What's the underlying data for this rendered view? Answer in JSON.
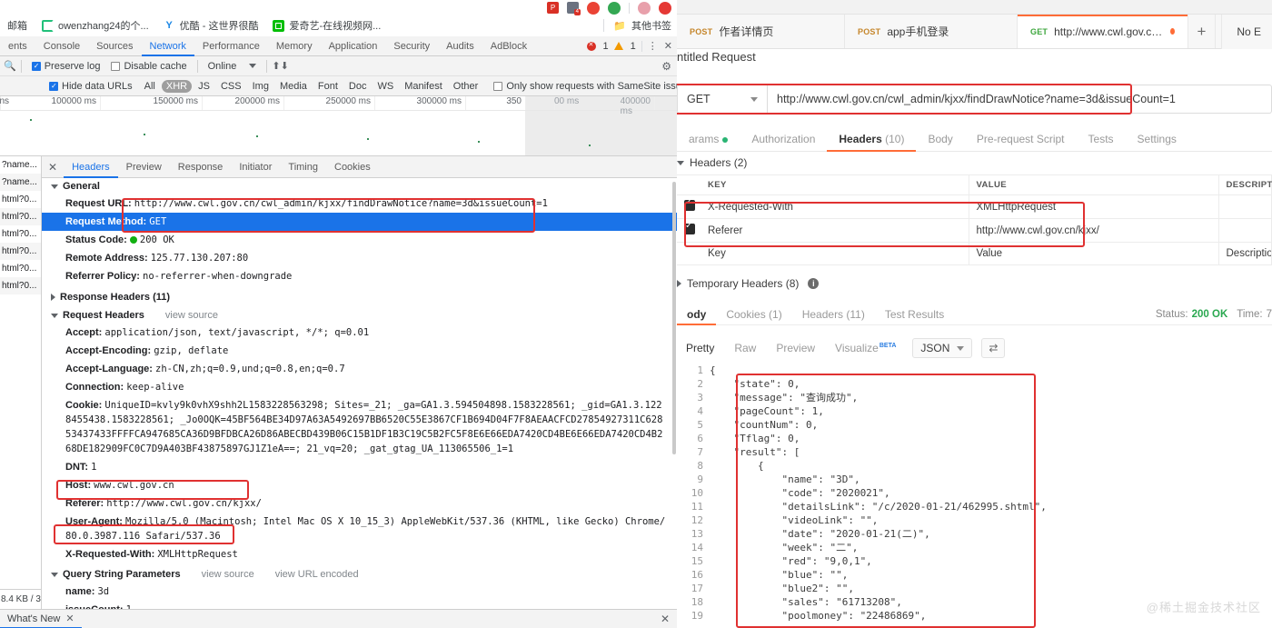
{
  "browser": {
    "bookmarks": [
      {
        "label": "邮箱",
        "icon": "none"
      },
      {
        "label": "owenzhang24的个...",
        "icon": "csdn-icon"
      },
      {
        "label": "优酷 - 这世界很酷",
        "icon": "youku-icon"
      },
      {
        "label": "爱奇艺-在线视频网...",
        "icon": "iqiyi-icon"
      }
    ],
    "other_bookmarks": "其他书签"
  },
  "devtools": {
    "tabs": [
      {
        "label": "ents",
        "active": false
      },
      {
        "label": "Console",
        "active": false
      },
      {
        "label": "Sources",
        "active": false
      },
      {
        "label": "Network",
        "active": true
      },
      {
        "label": "Performance",
        "active": false
      },
      {
        "label": "Memory",
        "active": false
      },
      {
        "label": "Application",
        "active": false
      },
      {
        "label": "Security",
        "active": false
      },
      {
        "label": "Audits",
        "active": false
      },
      {
        "label": "AdBlock",
        "active": false
      }
    ],
    "error_count": "1",
    "warning_count": "1",
    "toolbar": {
      "preserve_log": "Preserve log",
      "disable_cache": "Disable cache",
      "throttle": "Online"
    },
    "filters": {
      "hide_data_urls": "Hide data URLs",
      "types": [
        "All",
        "XHR",
        "JS",
        "CSS",
        "Img",
        "Media",
        "Font",
        "Doc",
        "WS",
        "Manifest",
        "Other"
      ],
      "active_type": "XHR",
      "samesite": "Only show requests with SameSite issues"
    },
    "overview_ticks": [
      "ns",
      "100000 ms",
      "150000 ms",
      "200000 ms",
      "250000 ms",
      "300000 ms",
      "350",
      "00 ms",
      "400000 ms"
    ],
    "filelist": [
      "?name...",
      "?name...",
      "html?0...",
      "html?0...",
      "html?0...",
      "html?0...",
      "html?0...",
      "html?0..."
    ],
    "detail_tabs": [
      "Headers",
      "Preview",
      "Response",
      "Initiator",
      "Timing",
      "Cookies"
    ],
    "detail_active_tab": "Headers",
    "general": {
      "section": "General",
      "rows": [
        {
          "key": "Request URL:",
          "value": "http://www.cwl.gov.cn/cwl_admin/kjxx/findDrawNotice?name=3d&issueCount=1"
        },
        {
          "key": "Request Method:",
          "value": "GET"
        },
        {
          "key": "Status Code:",
          "value": "200 OK"
        },
        {
          "key": "Remote Address:",
          "value": "125.77.130.207:80"
        },
        {
          "key": "Referrer Policy:",
          "value": "no-referrer-when-downgrade"
        }
      ]
    },
    "response_headers_title": "Response Headers (11)",
    "request_headers_title": "Request Headers",
    "view_source": "view source",
    "request_headers": [
      {
        "key": "Accept:",
        "value": "application/json, text/javascript, */*; q=0.01"
      },
      {
        "key": "Accept-Encoding:",
        "value": "gzip, deflate"
      },
      {
        "key": "Accept-Language:",
        "value": "zh-CN,zh;q=0.9,und;q=0.8,en;q=0.7"
      },
      {
        "key": "Connection:",
        "value": "keep-alive"
      },
      {
        "key": "Cookie:",
        "value": "UniqueID=kvly9k0vhX9shh2L1583228563298; Sites=_21; _ga=GA1.3.594504898.1583228561; _gid=GA1.3.1228455438.1583228561; _Jo0OQK=45BF564BE34D97A63A5492697BB6520C55E3867CF1B694D04F7F8AEAACFCD27854927311C62853437433FFFFCA947685CA36D9BFDBCA26D86ABECBD439B06C15B1DF1B3C19C5B2FC5F8E6E66EDA7420CD4BE6E66EDA7420CD4B268DE182909FC0C7D9A403BF43875897GJ1Z1eA==; 21_vq=20; _gat_gtag_UA_113065506_1=1"
      },
      {
        "key": "DNT:",
        "value": "1"
      },
      {
        "key": "Host:",
        "value": "www.cwl.gov.cn"
      },
      {
        "key": "Referer:",
        "value": "http://www.cwl.gov.cn/kjxx/"
      },
      {
        "key": "User-Agent:",
        "value": "Mozilla/5.0 (Macintosh; Intel Mac OS X 10_15_3) AppleWebKit/537.36 (KHTML, like Gecko) Chrome/80.0.3987.116 Safari/537.36"
      },
      {
        "key": "X-Requested-With:",
        "value": "XMLHttpRequest"
      }
    ],
    "query_section": {
      "title": "Query String Parameters",
      "view_source": "view source",
      "view_url_encoded": "view URL encoded",
      "rows": [
        {
          "key": "name:",
          "value": "3d"
        },
        {
          "key": "issueCount:",
          "value": "1"
        }
      ]
    },
    "transfer_size": "8.4 KB / 3",
    "whats_new": "What's New"
  },
  "postman": {
    "tabs": [
      {
        "method": "POST",
        "label": "作者详情页",
        "active": false,
        "unsaved": false
      },
      {
        "method": "POST",
        "label": "app手机登录",
        "active": false,
        "unsaved": false
      },
      {
        "method": "GET",
        "label": "http://www.cwl.gov.cn/cwl_adm...",
        "active": true,
        "unsaved": true
      }
    ],
    "environment": "No E",
    "request_title": "ntitled Request",
    "method": "GET",
    "url": "http://www.cwl.gov.cn/cwl_admin/kjxx/findDrawNotice?name=3d&issueCount=1",
    "request_tabs": [
      {
        "label": "arams",
        "active": false,
        "dot": true
      },
      {
        "label": "Authorization",
        "active": false
      },
      {
        "label": "Headers",
        "count": "(10)",
        "active": true
      },
      {
        "label": "Body",
        "active": false
      },
      {
        "label": "Pre-request Script",
        "active": false
      },
      {
        "label": "Tests",
        "active": false
      },
      {
        "label": "Settings",
        "active": false
      }
    ],
    "headers_section_title": "Headers (2)",
    "headers_columns": [
      "KEY",
      "VALUE",
      "DESCRIPTION"
    ],
    "headers_rows": [
      {
        "checked": true,
        "key": "X-Requested-With",
        "value": "XMLHttpRequest",
        "description": ""
      },
      {
        "checked": true,
        "key": "Referer",
        "value": "http://www.cwl.gov.cn/kjxx/",
        "description": ""
      }
    ],
    "headers_placeholder": {
      "key": "Key",
      "value": "Value",
      "description": "Description"
    },
    "temporary_headers": "Temporary Headers (8)",
    "response_tabs": [
      {
        "label": "ody",
        "active": true
      },
      {
        "label": "Cookies (1)",
        "active": false
      },
      {
        "label": "Headers (11)",
        "active": false
      },
      {
        "label": "Test Results",
        "active": false
      }
    ],
    "status_label": "Status:",
    "status_value": "200 OK",
    "time_label": "Time:",
    "time_value": "7",
    "view_modes": [
      "Pretty",
      "Raw",
      "Preview",
      "Visualize"
    ],
    "view_active": "Pretty",
    "beta_label": "BETA",
    "format": "JSON",
    "response_json": {
      "state": 0,
      "message": "查询成功",
      "pageCount": 1,
      "countNum": 0,
      "Tflag": 0,
      "result": [
        {
          "name": "3D",
          "code": "2020021",
          "detailsLink": "/c/2020-01-21/462995.shtml",
          "videoLink": "",
          "date": "2020-01-21(二)",
          "week": "二",
          "red": "9,0,1",
          "blue": "",
          "blue2": "",
          "sales": "61713208",
          "poolmoney": "22486869"
        }
      ]
    },
    "code_lines": [
      {
        "n": "1",
        "text": "{"
      },
      {
        "n": "2",
        "text": "    \"state\": 0,"
      },
      {
        "n": "3",
        "text": "    \"message\": \"查询成功\","
      },
      {
        "n": "4",
        "text": "    \"pageCount\": 1,"
      },
      {
        "n": "5",
        "text": "    \"countNum\": 0,"
      },
      {
        "n": "6",
        "text": "    \"Tflag\": 0,"
      },
      {
        "n": "7",
        "text": "    \"result\": ["
      },
      {
        "n": "8",
        "text": "        {"
      },
      {
        "n": "9",
        "text": "            \"name\": \"3D\","
      },
      {
        "n": "10",
        "text": "            \"code\": \"2020021\","
      },
      {
        "n": "11",
        "text": "            \"detailsLink\": \"/c/2020-01-21/462995.shtml\","
      },
      {
        "n": "12",
        "text": "            \"videoLink\": \"\","
      },
      {
        "n": "13",
        "text": "            \"date\": \"2020-01-21(二)\","
      },
      {
        "n": "14",
        "text": "            \"week\": \"二\","
      },
      {
        "n": "15",
        "text": "            \"red\": \"9,0,1\","
      },
      {
        "n": "16",
        "text": "            \"blue\": \"\","
      },
      {
        "n": "17",
        "text": "            \"blue2\": \"\","
      },
      {
        "n": "18",
        "text": "            \"sales\": \"61713208\","
      },
      {
        "n": "19",
        "text": "            \"poolmoney\": \"22486869\","
      }
    ],
    "watermark": "@稀土掘金技术社区"
  },
  "colors": {
    "annotation": "#e03131",
    "accent_orange": "#ff6c37",
    "accent_blue": "#1a73e8",
    "status_green": "#2aa850"
  }
}
